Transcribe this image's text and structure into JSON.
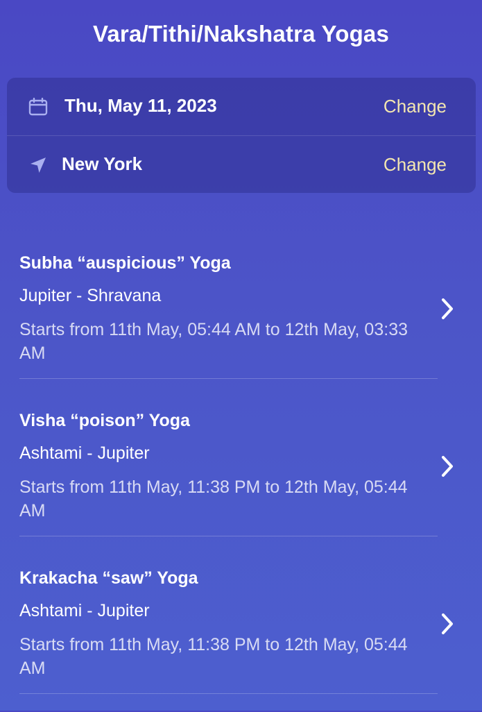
{
  "header": {
    "title": "Vara/Tithi/Nakshatra Yogas"
  },
  "settings": {
    "date": {
      "icon": "calendar-icon",
      "value": "Thu, May 11, 2023",
      "action": "Change"
    },
    "location": {
      "icon": "location-arrow-icon",
      "value": "New York",
      "action": "Change"
    }
  },
  "yogas": [
    {
      "name": "Subha “auspicious” Yoga",
      "combo": "Jupiter - Shravana",
      "timing": "Starts from 11th May, 05:44 AM to 12th May, 03:33 AM"
    },
    {
      "name": "Visha “poison” Yoga",
      "combo": "Ashtami - Jupiter",
      "timing": "Starts from 11th May, 11:38 PM to 12th May, 05:44 AM"
    },
    {
      "name": "Krakacha “saw” Yoga",
      "combo": "Ashtami - Jupiter",
      "timing": "Starts from 11th May, 11:38 PM to 12th May, 05:44 AM"
    }
  ],
  "colors": {
    "background": "#4b50c8",
    "accent": "#f3e6b0",
    "text": "#ffffff"
  }
}
